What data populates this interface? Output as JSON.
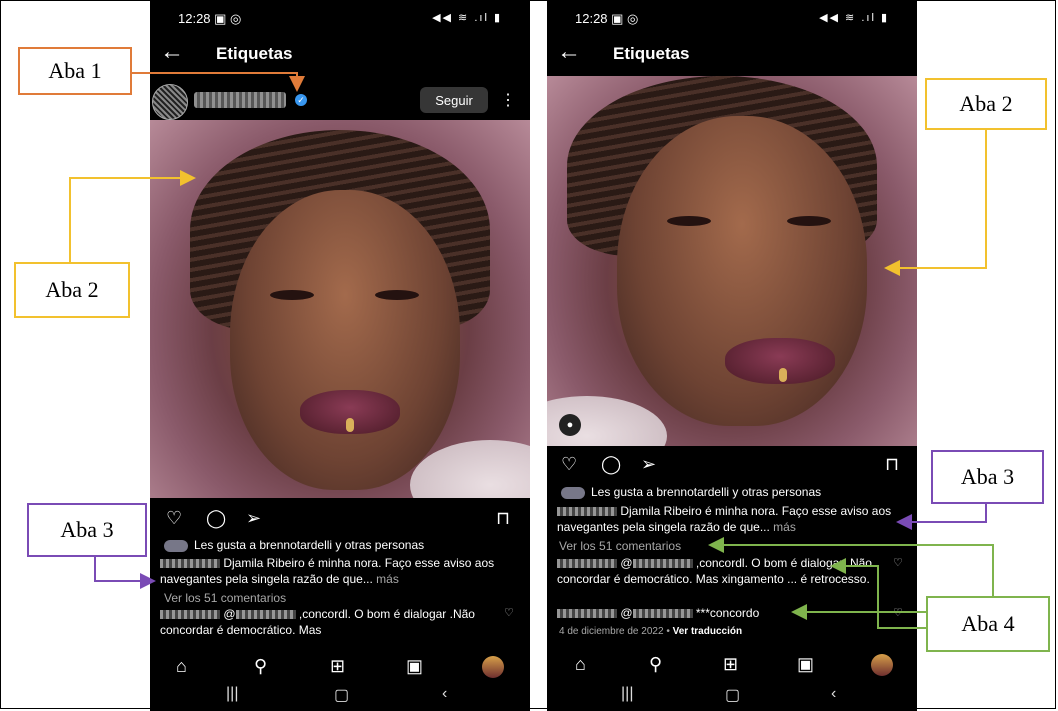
{
  "colors": {
    "aba1": "#E07B39",
    "aba2": "#F2C12E",
    "aba3": "#7A4BB5",
    "aba4": "#7FB44D",
    "verified": "#3897f0"
  },
  "labels": {
    "aba1": "Aba 1",
    "aba2": "Aba 2",
    "aba3": "Aba 3",
    "aba4": "Aba 4"
  },
  "phone1": {
    "status": {
      "time": "12:28 ▣ ◎",
      "icons": "◀◀ ≋ .ıl ▮"
    },
    "title": "Etiquetas",
    "follow": "Seguir",
    "likes": "Les gusta a brennotardelli y otras personas",
    "caption": "Djamila Ribeiro é minha nora. Faço esse aviso aos navegantes pela singela razão de que...",
    "more": "más",
    "view_comments": "Ver los 51 comentarios",
    "comment1": "@",
    "comment1_text": ",concordl. O bom é dialogar .Não concordar é democrático. Mas",
    "comment1_tail": "xingamento ... é retrocesso."
  },
  "phone2": {
    "status": {
      "time": "12:28 ▣ ◎",
      "icons": "◀◀ ≋ .ıl ▮"
    },
    "title": "Etiquetas",
    "likes": "Les gusta a brennotardelli y otras personas",
    "caption": "Djamila Ribeiro é minha nora. Faço esse aviso aos navegantes pela singela razão de que...",
    "more": "más",
    "view_comments": "Ver los 51 comentarios",
    "comment1": "@",
    "comment1_text": ",concordl. O bom é dialogar .Não concordar é democrático. Mas xingamento ... é retrocesso.",
    "comment2": "@",
    "comment2_text": "***concordo",
    "date": "4 de diciembre de 2022",
    "translate": "Ver traducción"
  }
}
